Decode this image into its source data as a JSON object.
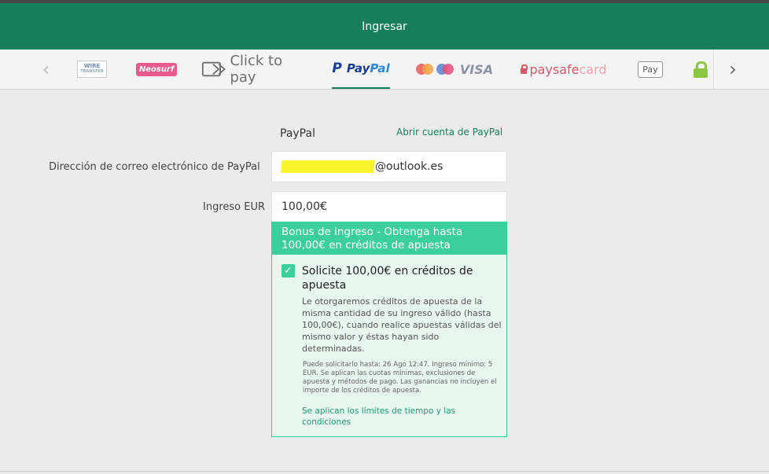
{
  "header": {
    "title": "Ingresar"
  },
  "methods": {
    "prev_arrow": "‹",
    "next_arrow": "›",
    "items": [
      {
        "name": "wire-transfer",
        "text": "WIRE",
        "subtext": "TRANSFER"
      },
      {
        "name": "neosurf",
        "text": "Neosurf"
      },
      {
        "name": "click-to-pay",
        "text": "Click to pay"
      },
      {
        "name": "paypal",
        "text_a": "Pay",
        "text_b": "Pal",
        "active": true
      },
      {
        "name": "mastercard-maestro-visa",
        "text": "VISA"
      },
      {
        "name": "paysafecard",
        "text_a": "paysafe",
        "text_b": "card"
      },
      {
        "name": "apple-pay",
        "text": "Pay"
      }
    ]
  },
  "form": {
    "method_title": "PayPal",
    "open_account_link": "Abrir cuenta de PayPal",
    "email_label": "Dirección de correo electrónico de PayPal",
    "email_value_visible": "@outlook.es",
    "amount_label": "Ingreso EUR",
    "amount_value": "100,00€"
  },
  "bonus": {
    "header": "Bonus de ingreso - Obtenga hasta 100,00€ en créditos de apuesta",
    "checked": true,
    "check_label": "Solicite 100,00€ en créditos de apuesta",
    "description": "Le otorgaremos créditos de apuesta de la misma cantidad de su ingreso válido (hasta 100,00€), cuando realice apuestas válidas del mismo valor y éstas hayan sido determinadas.",
    "terms": "Puede solicitarlo hasta: 26 Ago 12:47. Ingreso mínimo: 5 EUR. Se aplican las cuotas mínimas, exclusiones de apuesta y métodos de pago. Las ganancias no incluyen el importe de los créditos de apuesta.",
    "terms_link": "Se aplican los límites de tiempo y las condiciones"
  },
  "colors": {
    "brand": "#157f5c",
    "bonus_accent": "#3ccf9e",
    "background": "#ebebeb"
  }
}
